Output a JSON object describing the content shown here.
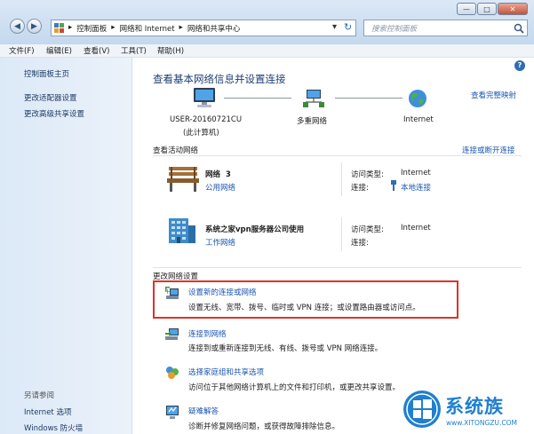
{
  "window": {
    "min": "—",
    "max": "□",
    "close": "✕"
  },
  "nav": {
    "back": "◀",
    "forward": "▶",
    "dropdown": "▾",
    "refresh": "↻"
  },
  "breadcrumb": [
    "▸",
    "控制面板",
    "▸",
    "网络和 Internet",
    "▸",
    "网络和共享中心"
  ],
  "search": {
    "placeholder": "搜索控制面板"
  },
  "menu": [
    "文件(F)",
    "编辑(E)",
    "查看(V)",
    "工具(T)",
    "帮助(H)"
  ],
  "sidebar": {
    "home": "控制面板主页",
    "links": [
      "更改适配器设置",
      "更改高级共享设置"
    ],
    "see_also_title": "另请参阅",
    "see_also": [
      "Internet 选项",
      "Windows 防火墙"
    ]
  },
  "main": {
    "help": "?",
    "title": "查看基本网络信息并设置连接",
    "full_map": "查看完整映射",
    "map": {
      "computer": "USER-20160721CU",
      "computer_sub": "(此计算机)",
      "multiple": "多重网络",
      "internet": "Internet"
    },
    "active_title": "查看活动网络",
    "connect_disconnect": "连接或断开连接",
    "networks": [
      {
        "name": "网络  3",
        "type": "公用网络",
        "access_label": "访问类型:",
        "access": "Internet",
        "conn_label": "连接:",
        "conn": "本地连接"
      },
      {
        "name": "系统之家vpn服务器公司使用",
        "type": "工作网络",
        "access_label": "访问类型:",
        "access": "Internet",
        "conn_label": "连接:",
        "conn": ""
      }
    ],
    "change_title": "更改网络设置",
    "tasks": [
      {
        "title": "设置新的连接或网络",
        "desc": "设置无线、宽带、拨号、临时或 VPN 连接；或设置路由器或访问点。"
      },
      {
        "title": "连接到网络",
        "desc": "连接到或重新连接到无线、有线、拨号或 VPN 网络连接。"
      },
      {
        "title": "选择家庭组和共享选项",
        "desc": "访问位于其他网络计算机上的文件和打印机，或更改共享设置。"
      },
      {
        "title": "疑难解答",
        "desc": "诊断并修复网络问题，或获得故障排除信息。"
      }
    ]
  },
  "watermark": {
    "brand": "系统族",
    "url": "www.XITONGZU.COM"
  },
  "colors": {
    "highlight_border": "#d9342b",
    "link": "#1a55b0",
    "heading": "#1e3f75"
  }
}
